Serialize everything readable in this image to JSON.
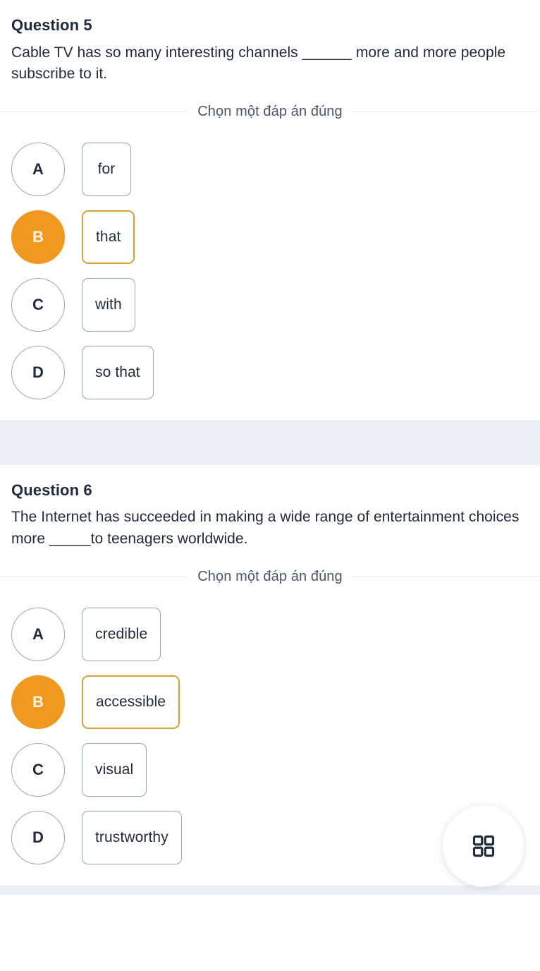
{
  "questions": [
    {
      "title": "Question 5",
      "text": "Cable TV has so many interesting channels ______ more and more people subscribe to it.",
      "instruction": "Chọn một đáp án đúng",
      "options": [
        {
          "letter": "A",
          "label": "for",
          "selected": false
        },
        {
          "letter": "B",
          "label": "that",
          "selected": true
        },
        {
          "letter": "C",
          "label": "with",
          "selected": false
        },
        {
          "letter": "D",
          "label": "so that",
          "selected": false
        }
      ]
    },
    {
      "title": "Question 6",
      "text": "The Internet has succeeded in making a wide range of entertainment choices more _____to teenagers worldwide.",
      "instruction": "Chọn một đáp án đúng",
      "options": [
        {
          "letter": "A",
          "label": "credible",
          "selected": false
        },
        {
          "letter": "B",
          "label": "accessible",
          "selected": true
        },
        {
          "letter": "C",
          "label": "visual",
          "selected": false
        },
        {
          "letter": "D",
          "label": "trustworthy",
          "selected": false
        }
      ]
    }
  ],
  "fab": {
    "icon": "grid-2x2-icon"
  },
  "colors": {
    "selected_fill": "#ef9920",
    "selected_border": "#d4a437",
    "unselected_border": "#9aa7b4",
    "text": "#202b3c",
    "muted_text": "#4a5568",
    "band": "#eceff4",
    "rule": "#e4e8ee"
  }
}
